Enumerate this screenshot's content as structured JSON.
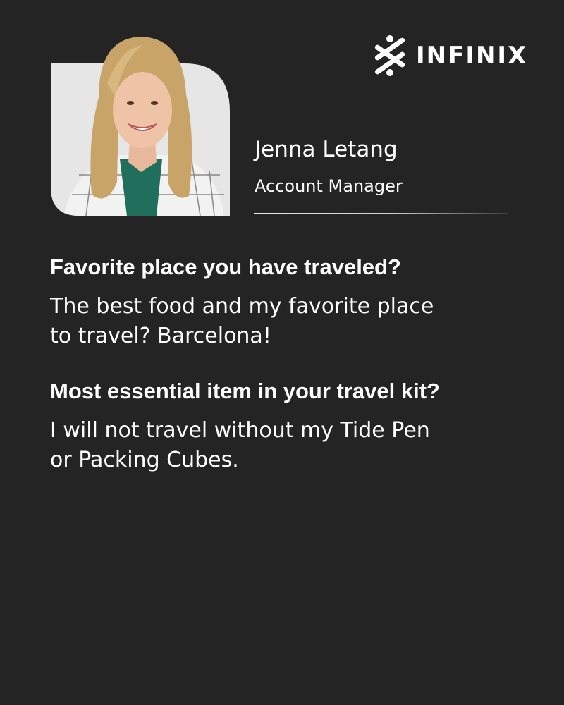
{
  "brand": {
    "name": "INFINIX",
    "logo_icon": "infinix-mark-icon"
  },
  "profile": {
    "photo": "portrait-photo",
    "name": "Jenna Letang",
    "title": "Account Manager"
  },
  "qa": [
    {
      "question": "Favorite place you have traveled?",
      "answer": "The best food and my favorite place\nto travel? Barcelona!"
    },
    {
      "question": "Most essential item in your travel kit?",
      "answer": "I will not travel without my Tide Pen\nor Packing Cubes."
    }
  ],
  "colors": {
    "background": "#242424",
    "text": "#ffffff",
    "photo_card": "#e6e6e6"
  }
}
